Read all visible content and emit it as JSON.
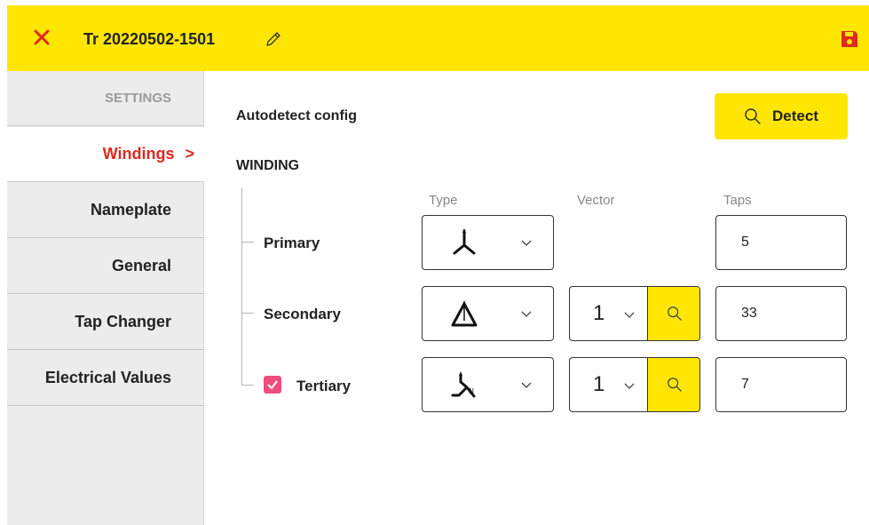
{
  "header": {
    "title": "Tr 20220502-1501",
    "close_icon": "close-icon",
    "edit_icon": "pencil-icon",
    "save_icon": "floppy-save-icon",
    "accent": "#ffe600",
    "danger": "#e0281e"
  },
  "sidebar": {
    "heading": "SETTINGS",
    "items": [
      {
        "label": "Windings",
        "active": true,
        "chevron": ">"
      },
      {
        "label": "Nameplate"
      },
      {
        "label": "General"
      },
      {
        "label": "Tap Changer"
      },
      {
        "label": "Electrical Values"
      }
    ]
  },
  "main": {
    "autodetect_label": "Autodetect config",
    "detect_button": "Detect",
    "section_title": "WINDING",
    "columns": {
      "type": "Type",
      "vector": "Vector",
      "taps": "Taps"
    },
    "windings": [
      {
        "name": "Primary",
        "type_icon": "wye-symbol-icon",
        "vector": null,
        "taps": "5"
      },
      {
        "name": "Secondary",
        "type_icon": "delta-symbol-icon",
        "vector": "1",
        "taps": "33"
      },
      {
        "name": "Tertiary",
        "type_icon": "zigzag-neutral-symbol-icon",
        "vector": "1",
        "taps": "7",
        "checked": true
      }
    ]
  }
}
